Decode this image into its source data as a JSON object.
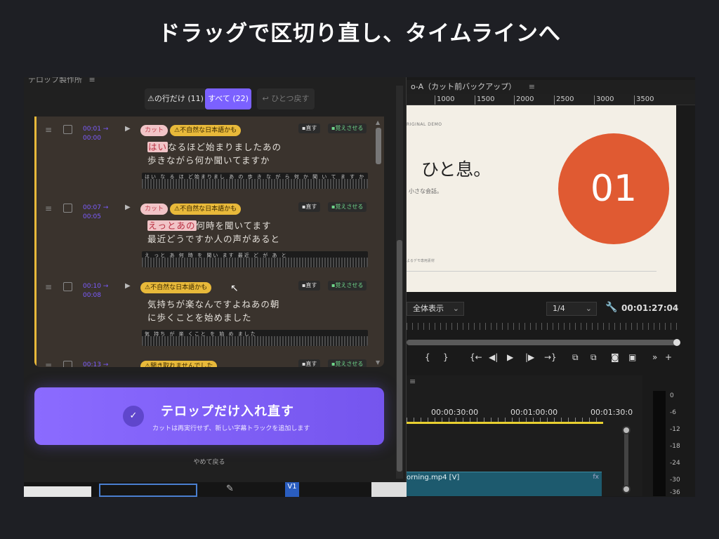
{
  "slide_title": "ドラッグで区切り直し、タイムラインへ",
  "program_monitor": {
    "title": "o-A（カット前バックアップ）",
    "menu_icon": "≡",
    "ruler_ticks": [
      "1000",
      "1500",
      "2000",
      "2500",
      "3000",
      "3500"
    ],
    "preview": {
      "demo_label": "RIGINAL DEMO",
      "main_text": "ひと息。",
      "sub_text": "小さな会話。",
      "circle_number": "01",
      "footnote": "よるデモ専用素材"
    },
    "fit_select": "全体表示",
    "resolution_select": "1/4",
    "timecode": "00:01:27:04",
    "transport_icons": [
      "{",
      "}",
      "{←",
      "◀|",
      "▶",
      "|▶",
      "→}",
      "⧉",
      "⧉",
      "◙",
      "▣",
      "»",
      "+"
    ]
  },
  "timeline": {
    "menu_icon": "≡",
    "times": [
      "00:00:30:00",
      "00:01:00:00",
      "00:01:30:0"
    ],
    "clip_name": "orning.mp4 [V]",
    "fx": "fx",
    "track_label": "V1"
  },
  "meter_labels": [
    "0",
    "-6",
    "-12",
    "-18",
    "-24",
    "-30",
    "-36"
  ],
  "telop_panel": {
    "title": "テロップ製作所",
    "menu_icon": "≡",
    "tabs": {
      "warn": "⚠の行だけ (11)",
      "all": "すべて (22)",
      "undo": "↩ ひとつ戻す"
    },
    "rows": [
      {
        "time": "00:01 →\n00:00",
        "badges": {
          "cut": "カット",
          "warn": "⚠不自然な日本語かも"
        },
        "fix": "▪直す",
        "learn": "▪覚えさせる",
        "line1_hl": "はい",
        "line1_rest": "なるほど始まりましたあの",
        "line2": "歩きながら何か聞いてますか",
        "wave_labels": "はい な る ほ ど始まりまし あ の 歩 き な が ら 何 か 聞 い て ま す か"
      },
      {
        "time": "00:07 →\n00:05",
        "badges": {
          "cut": "カット",
          "warn": "⚠不自然な日本語かも"
        },
        "fix": "▪直す",
        "learn": "▪覚えさせる",
        "line1_hl": "えっとあの",
        "line1_rest": "何時を聞いてます",
        "line2": "最近どうですか人の声があると",
        "wave_labels": "え っと あ 何 時 を 聞い ます 最近 ど が あ と"
      },
      {
        "time": "00:10 →\n00:08",
        "badges": {
          "warn": "⚠不自然な日本語かも"
        },
        "fix": "▪直す",
        "learn": "▪覚えさせる",
        "line1": "気持ちが楽なんですよねあの朝",
        "line2": "に歩くことを始めました",
        "wave_labels": "気 持ち が 楽 くこと を 始 め ました"
      },
      {
        "time": "00:13 →",
        "badges": {
          "warn": "⚠聞き取れませんでした"
        },
        "fix": "▪直す",
        "learn": "▪覚えさせる"
      }
    ],
    "cta": {
      "check_icon": "✓",
      "title": "テロップだけ入れ直す",
      "subtitle": "カットは再実行せず、新しい字幕トラックを追加します"
    },
    "cancel": "やめて戻る"
  }
}
